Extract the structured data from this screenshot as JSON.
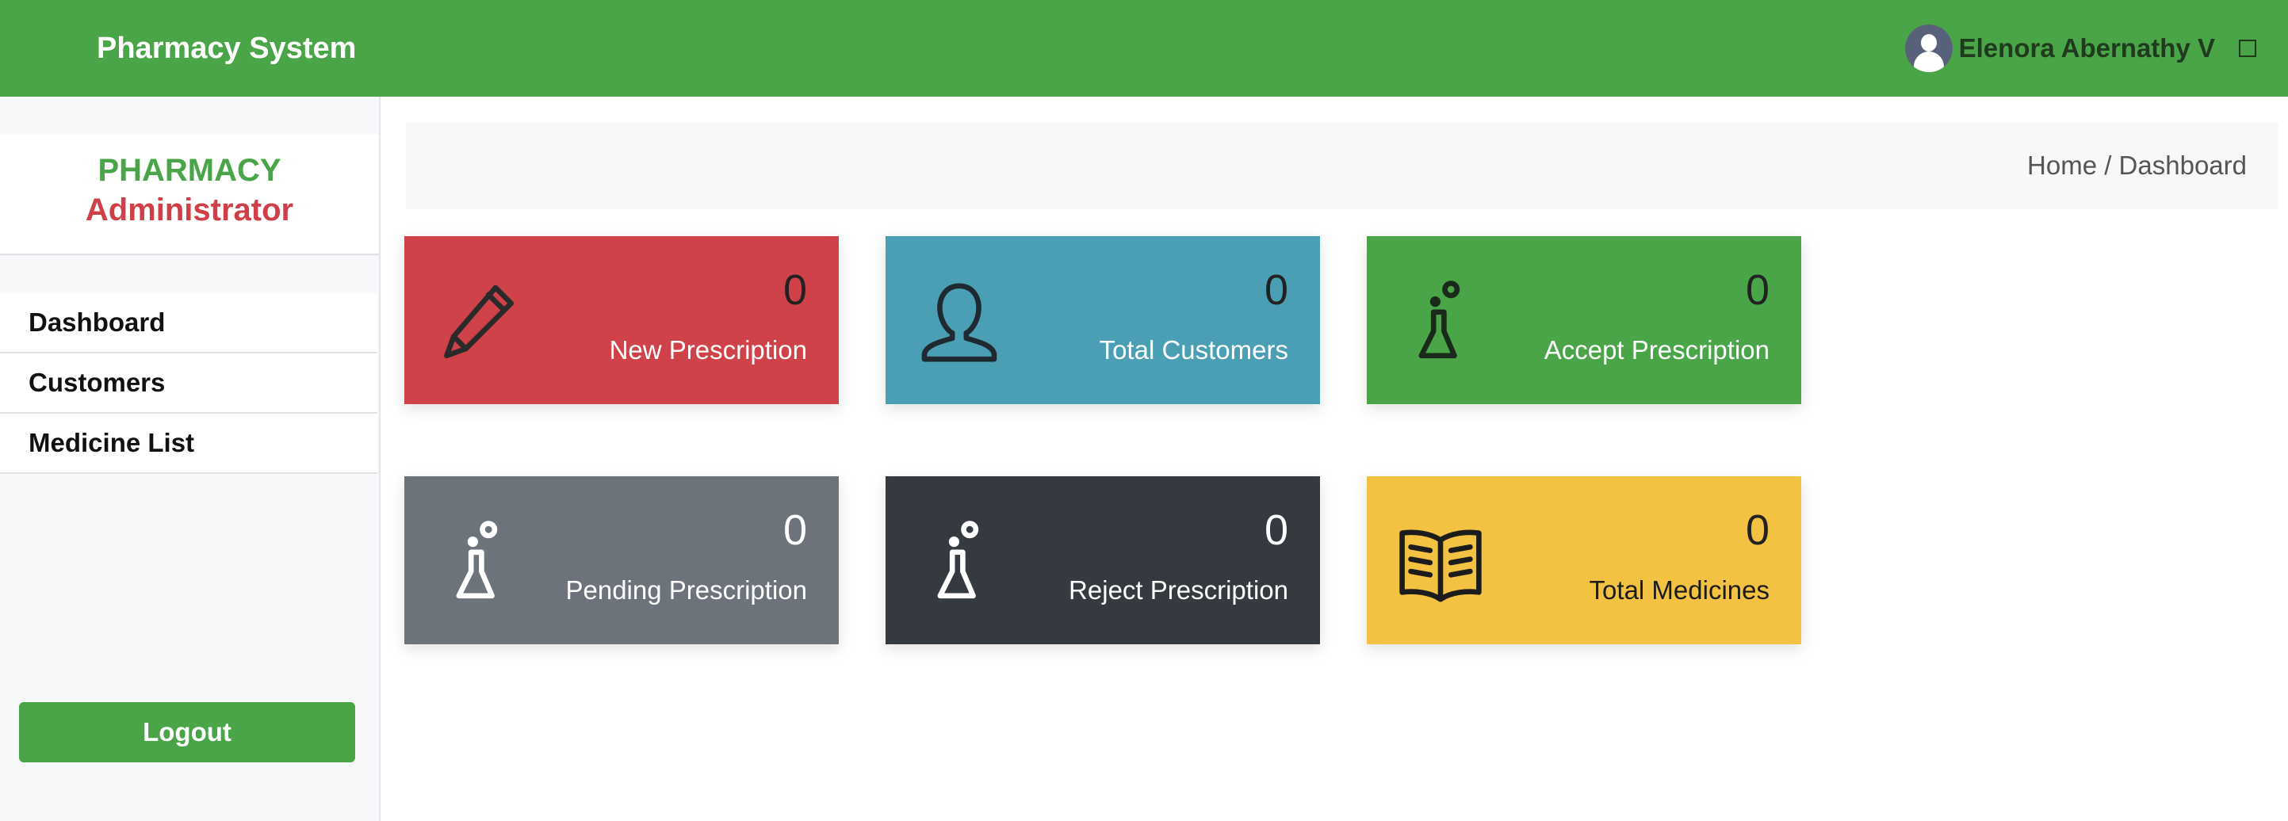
{
  "header": {
    "brand": "Pharmacy System",
    "user_name": "Elenora Abernathy V"
  },
  "sidebar": {
    "title": "PHARMACY",
    "subtitle": "Administrator",
    "items": [
      {
        "label": "Dashboard"
      },
      {
        "label": "Customers"
      },
      {
        "label": "Medicine List"
      }
    ],
    "logout_label": "Logout"
  },
  "breadcrumb": {
    "text": "Home / Dashboard"
  },
  "cards": [
    {
      "value": "0",
      "label": "New Prescription",
      "icon": "pencil-icon",
      "color": "#cf4249"
    },
    {
      "value": "0",
      "label": "Total Customers",
      "icon": "user-icon",
      "color": "#4b9fb5"
    },
    {
      "value": "0",
      "label": "Accept Prescription",
      "icon": "flask-icon",
      "color": "#4aa548"
    },
    {
      "value": "0",
      "label": "Pending Prescription",
      "icon": "flask-icon",
      "color": "#6c737b"
    },
    {
      "value": "0",
      "label": "Reject Prescription",
      "icon": "flask-icon",
      "color": "#343a40"
    },
    {
      "value": "0",
      "label": "Total Medicines",
      "icon": "book-icon",
      "color": "#f4c242"
    }
  ],
  "colors": {
    "primary": "#4aa548",
    "accent_red": "#cf3f47"
  }
}
